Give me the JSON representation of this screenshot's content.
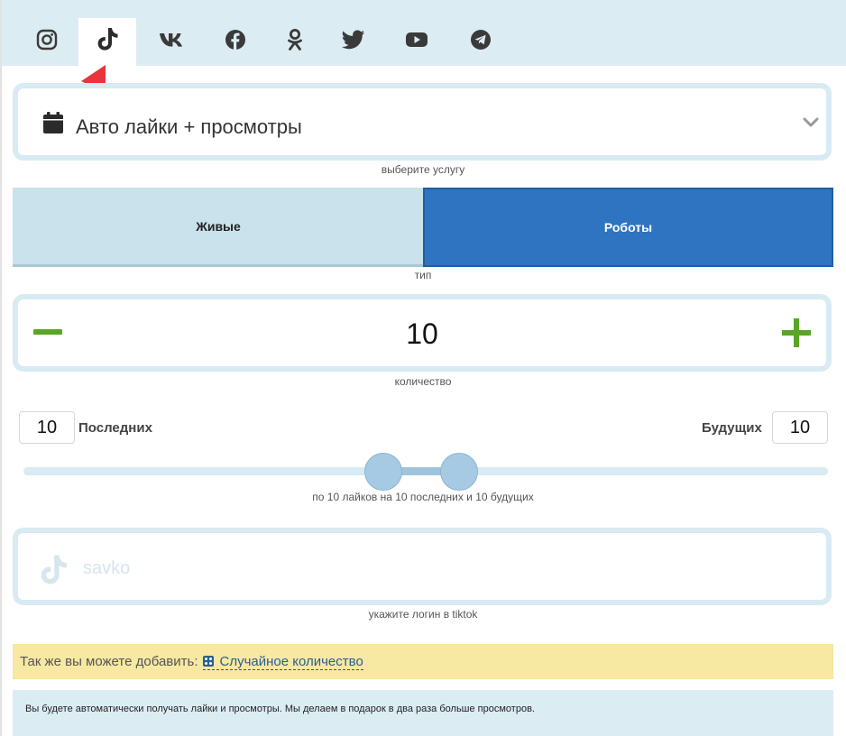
{
  "tabs": [
    {
      "name": "instagram-icon",
      "active": false
    },
    {
      "name": "tiktok-icon",
      "active": true
    },
    {
      "name": "vk-icon",
      "active": false
    },
    {
      "name": "facebook-icon",
      "active": false
    },
    {
      "name": "odnoklassniki-icon",
      "active": false
    },
    {
      "name": "twitter-icon",
      "active": false
    },
    {
      "name": "youtube-icon",
      "active": false
    },
    {
      "name": "telegram-icon",
      "active": false
    }
  ],
  "service": {
    "selected": "Авто лайки + просмотры",
    "hint": "выберите услугу",
    "icon": "calendar-icon"
  },
  "type": {
    "options": [
      "Живые",
      "Роботы"
    ],
    "selected": "Роботы",
    "hint": "тип"
  },
  "quantity": {
    "value": "10",
    "hint": "количество"
  },
  "posts": {
    "last_value": "10",
    "last_label": "Последних",
    "future_label": "Будущих",
    "future_value": "10",
    "summary": "по 10 лайков на 10 последних и 10 будущих"
  },
  "login": {
    "placeholder": "savko",
    "hint": "укажите логин в tiktok"
  },
  "extras": {
    "text": "Так же вы можете добавить:",
    "link": "Случайное количество"
  },
  "info": {
    "text": "Вы будете автоматически получать лайки и просмотры. Мы делаем в подарок в два раза больше просмотров."
  },
  "colors": {
    "accent_blue": "#2f74c0",
    "plus_minus_green": "#5aa526",
    "light_blue": "#dcecf3",
    "yellow_notice": "#f7e8a2",
    "arrow_red": "#e8353b"
  }
}
